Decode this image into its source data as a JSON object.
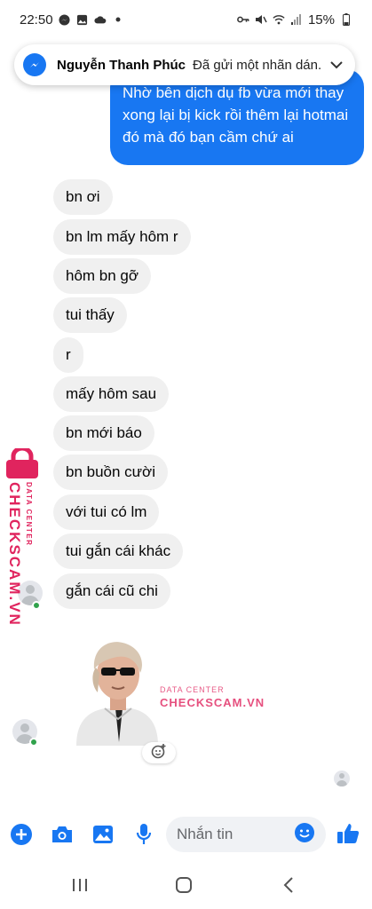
{
  "status_bar": {
    "time": "22:50",
    "battery": "15%"
  },
  "notification": {
    "sender": "Nguyễn Thanh Phúc",
    "message": "Đã gửi một nhãn dán."
  },
  "outgoing": [
    {
      "text": "Nhờ bên dịch dụ fb vừa mới thay xong lại bị kick rồi thêm lại hotmai đó mà đó bạn cầm chứ ai"
    }
  ],
  "incoming": [
    {
      "text": "bn ơi"
    },
    {
      "text": "bn lm mấy hôm r"
    },
    {
      "text": "hôm bn gỡ"
    },
    {
      "text": "tui thấy"
    },
    {
      "text": "r"
    },
    {
      "text": "mấy hôm sau"
    },
    {
      "text": "bn mới báo"
    },
    {
      "text": "bn buồn cười"
    },
    {
      "text": "với tui có lm"
    },
    {
      "text": "tui gắn cái khác"
    },
    {
      "text": "gắn cái cũ chi"
    }
  ],
  "watermark": {
    "brand": "CHECKSCAM.VN",
    "sub": "DATA CENTER"
  },
  "composer": {
    "placeholder": "Nhắn tin"
  },
  "colors": {
    "accent": "#1877f2",
    "bubble_in": "#f0f0f0",
    "online": "#31a24c",
    "watermark": "#e0245e"
  }
}
